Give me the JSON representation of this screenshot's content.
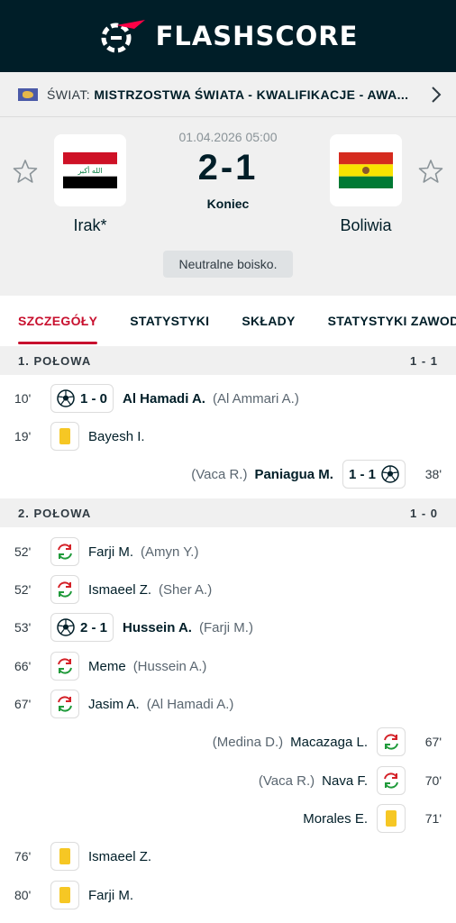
{
  "header": {
    "brand": "FLASHSCORE"
  },
  "breadcrumb": {
    "country": "ŚWIAT:",
    "league": "MISTRZOSTWA ŚWIATA - KWALIFIKACJE - AWA..."
  },
  "match": {
    "datetime": "01.04.2026 05:00",
    "score": "2-1",
    "status": "Koniec",
    "home": {
      "name": "Irak*"
    },
    "away": {
      "name": "Boliwia"
    },
    "note": "Neutralne boisko."
  },
  "tabs": [
    {
      "label": "SZCZEGÓŁY"
    },
    {
      "label": "STATYSTYKI"
    },
    {
      "label": "SKŁADY"
    },
    {
      "label": "STATYSTYKI ZAWODNIKÓW"
    }
  ],
  "halves": [
    {
      "label": "1. POŁOWA",
      "score": "1 - 1"
    },
    {
      "label": "2. POŁOWA",
      "score": "1 - 0"
    }
  ],
  "events": [
    {
      "minute": "10'",
      "score": "1 - 0",
      "player": "Al Hamadi A.",
      "assist": "(Al Ammari A.)"
    },
    {
      "minute": "19'",
      "player": "Bayesh I."
    },
    {
      "minute": "38'",
      "score": "1 - 1",
      "player": "Paniagua M.",
      "assist": "(Vaca R.)"
    },
    {
      "minute": "52'",
      "player": "Farji M.",
      "assist": "(Amyn Y.)"
    },
    {
      "minute": "52'",
      "player": "Ismaeel Z.",
      "assist": "(Sher A.)"
    },
    {
      "minute": "53'",
      "score": "2 - 1",
      "player": "Hussein A.",
      "assist": "(Farji M.)"
    },
    {
      "minute": "66'",
      "player": "Meme",
      "assist": "(Hussein A.)"
    },
    {
      "minute": "67'",
      "player": "Jasim A.",
      "assist": "(Al Hamadi A.)"
    },
    {
      "minute": "67'",
      "player": "Macazaga L.",
      "assist": "(Medina D.)"
    },
    {
      "minute": "70'",
      "player": "Nava F.",
      "assist": "(Vaca R.)"
    },
    {
      "minute": "71'",
      "player": "Morales E."
    },
    {
      "minute": "76'",
      "player": "Ismaeel Z."
    },
    {
      "minute": "80'",
      "player": "Farji M."
    }
  ],
  "colors": {
    "brand_dark": "#001e28",
    "accent_red": "#c8102e",
    "yellow_card": "#f6c724",
    "sub_green": "#1f9a3a",
    "sub_red": "#d42027"
  },
  "icons": {
    "goal": "soccer-ball-icon",
    "card": "yellow-card-icon",
    "substitution": "substitution-icon",
    "favorite": "star-icon",
    "nav": "chevron-right-icon"
  }
}
